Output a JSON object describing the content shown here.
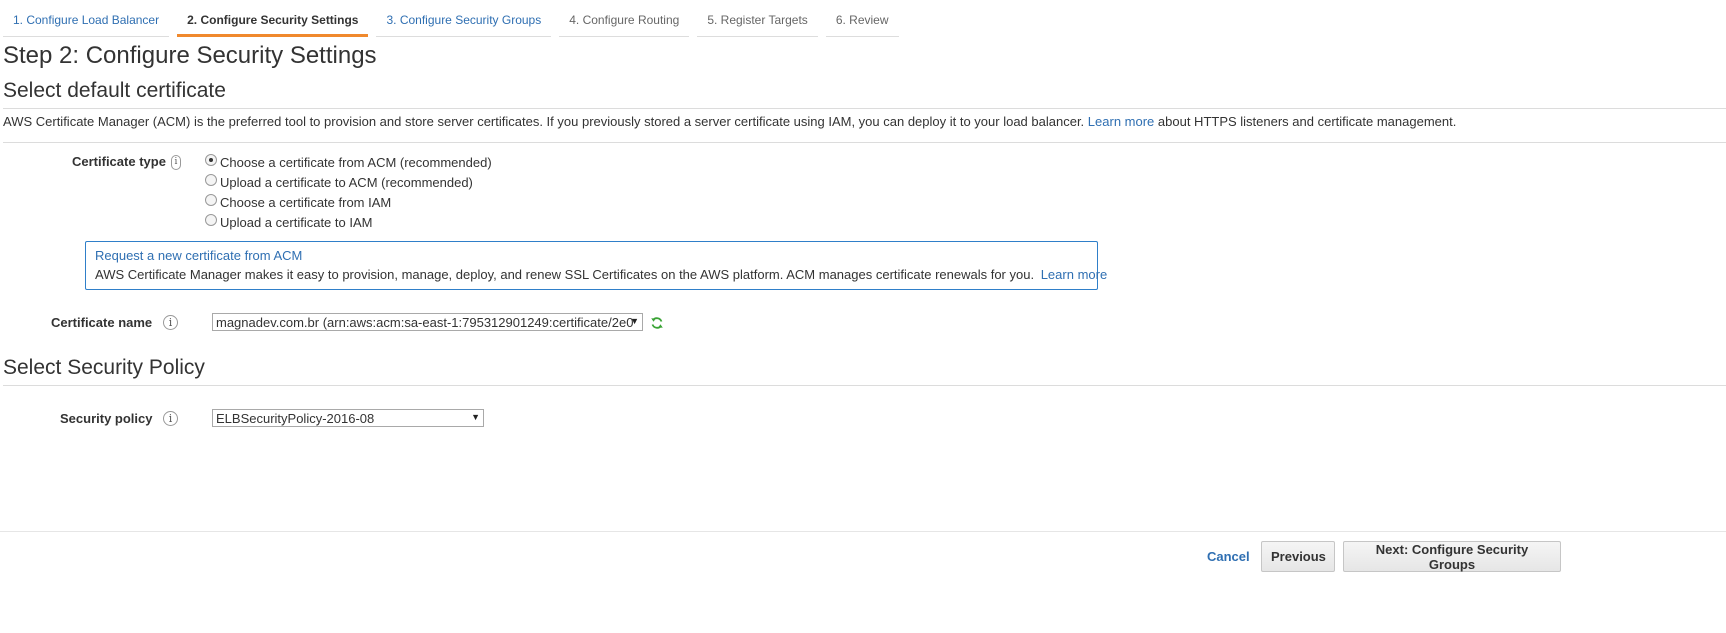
{
  "wizard": {
    "tabs": [
      {
        "label": "1. Configure Load Balancer"
      },
      {
        "label": "2. Configure Security Settings"
      },
      {
        "label": "3. Configure Security Groups"
      },
      {
        "label": "4. Configure Routing"
      },
      {
        "label": "5. Register Targets"
      },
      {
        "label": "6. Review"
      }
    ],
    "active_tab": "2. Configure Security Settings"
  },
  "page": {
    "title": "Step 2: Configure Security Settings"
  },
  "certificate_section": {
    "title": "Select default certificate",
    "intro_text": "AWS Certificate Manager (ACM) is the preferred tool to provision and store server certificates. If you previously stored a server certificate using IAM, you can deploy it to your load balancer.",
    "intro_link": "Learn more",
    "intro_suffix": "about HTTPS listeners and certificate management.",
    "certificate_type_label": "Certificate type",
    "certificate_type_options": [
      {
        "label": "Choose a certificate from ACM (recommended)",
        "selected": true
      },
      {
        "label": "Upload a certificate to ACM (recommended)",
        "selected": false
      },
      {
        "label": "Choose a certificate from IAM",
        "selected": false
      },
      {
        "label": "Upload a certificate to IAM",
        "selected": false
      }
    ],
    "acm_box": {
      "link": "Request a new certificate from ACM",
      "text": "AWS Certificate Manager makes it easy to provision, manage, deploy, and renew SSL Certificates on the AWS platform. ACM manages certificate renewals for you.",
      "learn_more": "Learn more"
    },
    "certificate_name_label": "Certificate name",
    "certificate_name_value": "magnadev.com.br (arn:aws:acm:sa-east-1:795312901249:certificate/2e0",
    "refresh_icon": "refresh-icon"
  },
  "policy_section": {
    "title": "Select Security Policy",
    "security_policy_label": "Security policy",
    "security_policy_value": "ELBSecurityPolicy-2016-08"
  },
  "footer": {
    "cancel_label": "Cancel",
    "previous_label": "Previous",
    "next_label": "Next: Configure Security Groups"
  },
  "colors": {
    "link": "#2f6fb2",
    "active_tab_underline": "#f0892d",
    "info_box_border": "#2f7fc9"
  }
}
